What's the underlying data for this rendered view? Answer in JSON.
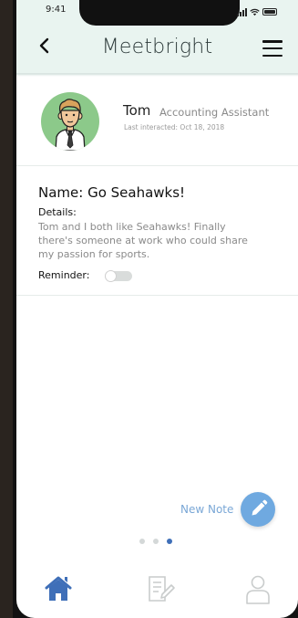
{
  "status_bar": {
    "time": "9:41"
  },
  "header": {
    "title": "Meetbright",
    "back_icon": "chevron-left-icon",
    "menu_icon": "hamburger-menu-icon"
  },
  "profile": {
    "name": "Tom",
    "role": "Accounting Assistant",
    "last_interacted": "Last interacted: Oct 18, 2018",
    "avatar_bg": "#8cc98a"
  },
  "note": {
    "name": "Name: Go Seahawks!",
    "details_label": "Details:",
    "details_text": "Tom and I both like Seahawks! Finally there's someone at work who could share my passion for sports.",
    "reminder_label": "Reminder:",
    "reminder_on": false
  },
  "actions": {
    "new_note_label": "New Note",
    "fab_icon": "pencil-icon",
    "accent": "#6fa9e0"
  },
  "pagination": {
    "count": 3,
    "active_index": 2
  },
  "tabbar": {
    "items": [
      {
        "icon": "home-icon",
        "active": true
      },
      {
        "icon": "notes-icon",
        "active": false
      },
      {
        "icon": "profile-icon",
        "active": false
      }
    ],
    "active_color": "#3f6fb8"
  }
}
